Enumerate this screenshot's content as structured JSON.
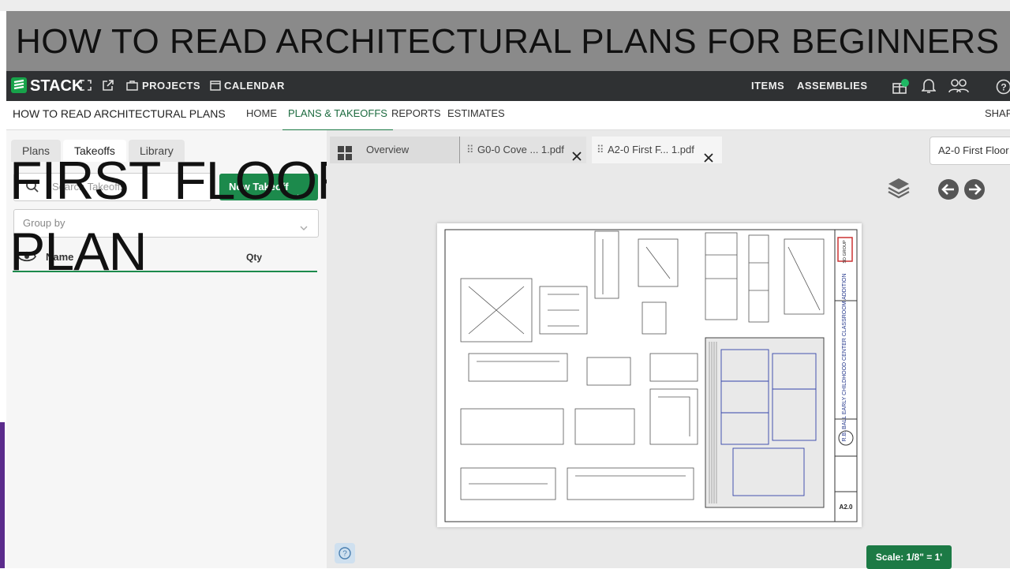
{
  "banner": {
    "title": "HOW TO READ ARCHITECTURAL PLANS FOR BEGINNERS"
  },
  "appnav": {
    "logo": "STACK",
    "projects": "PROJECTS",
    "calendar": "CALENDAR",
    "items": "ITEMS",
    "assemblies": "ASSEMBLIES"
  },
  "subheader": {
    "project": "HOW TO READ ARCHITECTURAL PLANS",
    "home": "HOME",
    "plans_takeoffs": "PLANS & TAKEOFFS",
    "reports": "REPORTS",
    "estimates": "ESTIMATES",
    "share": "SHAR"
  },
  "leftpanel": {
    "tabs": [
      "Plans",
      "Takeoffs",
      "Library"
    ],
    "search_placeholder": "Search Takeoffs",
    "new_takeoff": "New Takeoff",
    "group_by": "Group by",
    "col_name": "Name",
    "col_qty": "Qty"
  },
  "overlay": {
    "line1": "FIRST FLOOR",
    "line2": "PLAN"
  },
  "viewer": {
    "tabs": [
      "Overview",
      "G0-0 Cove ... 1.pdf",
      "A2-0 First F... 1.pdf"
    ],
    "sheet_select": "A2-0 First Floor",
    "scale": "Scale: 1/8\" = 1'",
    "titleblock_firm": "SD GROUP",
    "titleblock_project": "R.B. BALL EARLY CHILDHOOD CENTER CLASSROOM ADDITION",
    "sheet_number": "A2.0"
  },
  "colors": {
    "accent": "#1c8a4c",
    "nav": "#2f3133",
    "banner": "#8a8a8a"
  }
}
